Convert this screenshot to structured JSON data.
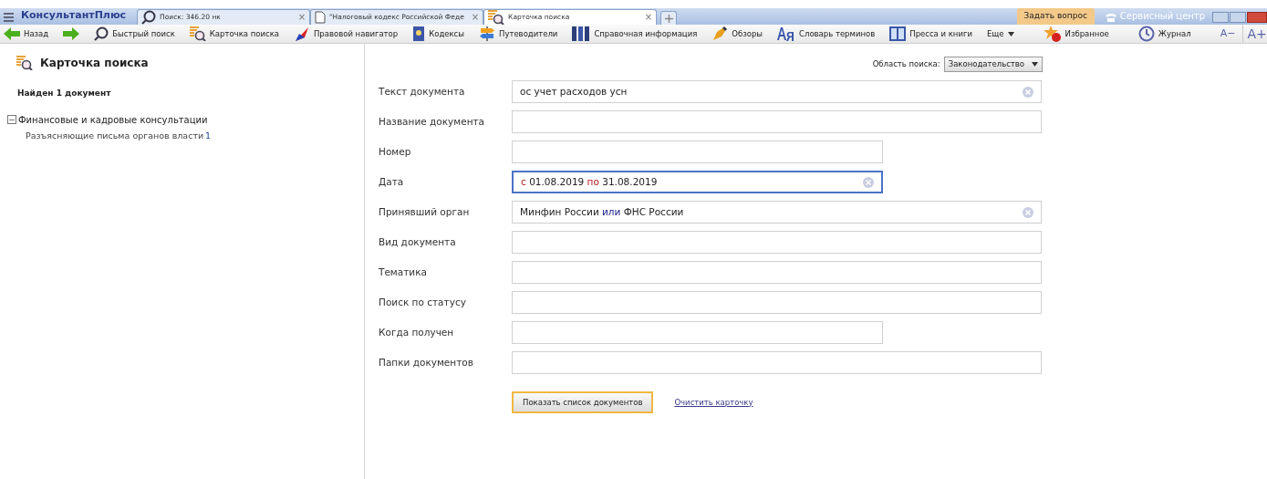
{
  "app_menu": {
    "logo": "КонсультантПлюс"
  },
  "tabs": [
    {
      "label": "Поиск: 346.20 нк",
      "kind": "search",
      "selected": false,
      "close": "×"
    },
    {
      "label": "\"Налоговый кодекс Российской Феде",
      "kind": "document",
      "selected": false,
      "close": "×"
    },
    {
      "label": "Карточка поиска",
      "kind": "card",
      "selected": true,
      "close": "×"
    }
  ],
  "title_actions": {
    "ask": "Задать вопрос",
    "service": "Сервисный центр"
  },
  "toolbar": [
    {
      "label": "Назад",
      "kind": "back"
    },
    {
      "kind": "forward"
    },
    {
      "label": "Быстрый поиск",
      "kind": "search"
    },
    {
      "label": "Карточка поиска",
      "kind": "card"
    },
    {
      "label": "Правовой навигатор",
      "kind": "navigator"
    },
    {
      "label": "Кодексы",
      "kind": "codes"
    },
    {
      "label": "Путеводители",
      "kind": "guides"
    },
    {
      "label": "Справочная информация",
      "kind": "reference"
    },
    {
      "label": "Обзоры",
      "kind": "reviews"
    },
    {
      "label": "Словарь терминов",
      "kind": "dictionary"
    },
    {
      "label": "Пресса и книги",
      "kind": "press"
    },
    {
      "label": "Еще",
      "kind": "more"
    }
  ],
  "toolbar_right": [
    {
      "label": "Избранное",
      "kind": "favorites"
    },
    {
      "label": "Журнал",
      "kind": "history"
    }
  ],
  "font_size": {
    "smaller": "A−",
    "larger": "A+"
  },
  "sidebar": {
    "title": "Карточка поиска",
    "found": "Найден 1 документ",
    "tree": [
      {
        "label": "Финансовые и кадровые консультации",
        "expanded": true,
        "toggle": "−",
        "children": [
          {
            "label": "Разъясняющие письма органов власти",
            "count": "1"
          }
        ]
      }
    ]
  },
  "search_area": {
    "label": "Область поиска:",
    "value": "Законодательство"
  },
  "fields": [
    {
      "label": "Текст документа",
      "wide": true,
      "focused": false,
      "value": [
        {
          "text": "ос учет расходов усн",
          "kind": "plain"
        }
      ]
    },
    {
      "label": "Название документа",
      "wide": true,
      "focused": false
    },
    {
      "label": "Номер",
      "wide": false,
      "focused": false
    },
    {
      "label": "Дата",
      "wide": false,
      "focused": true,
      "value": [
        {
          "text": "с",
          "kind": "keyword"
        },
        {
          "text": "01.08.2019",
          "kind": "plain"
        },
        {
          "text": "по",
          "kind": "keyword"
        },
        {
          "text": "31.08.2019",
          "kind": "plain"
        }
      ]
    },
    {
      "label": "Принявший орган",
      "wide": true,
      "focused": false,
      "value": [
        {
          "text": "Минфин России",
          "kind": "plain"
        },
        {
          "text": "или",
          "kind": "operator"
        },
        {
          "text": "ФНС России",
          "kind": "plain"
        }
      ]
    },
    {
      "label": "Вид документа",
      "wide": true,
      "focused": false
    },
    {
      "label": "Тематика",
      "wide": true,
      "focused": false
    },
    {
      "label": "Поиск по статусу",
      "wide": true,
      "focused": false
    },
    {
      "label": "Когда получен",
      "wide": false,
      "focused": false
    },
    {
      "label": "Папки документов",
      "wide": true,
      "focused": false
    }
  ],
  "actions": {
    "show": "Показать список документов",
    "clear": "Очистить карточку"
  }
}
